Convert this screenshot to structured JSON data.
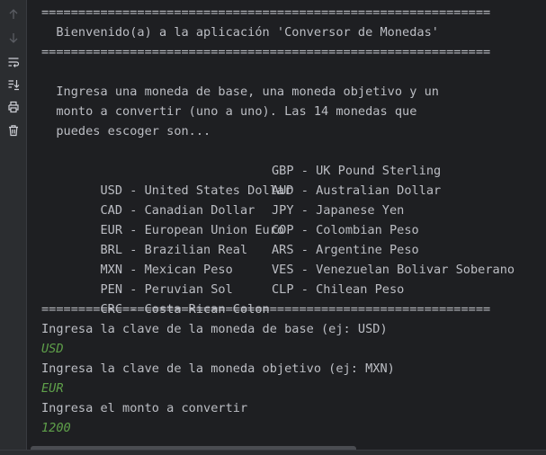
{
  "toolbar": {
    "icons": [
      "arrow-up-icon",
      "arrow-down-icon",
      "soft-wrap-icon",
      "scroll-to-end-icon",
      "print-icon",
      "trash-icon"
    ]
  },
  "console": {
    "separator": "=============================================================",
    "welcome": "  Bienvenido(a) a la aplicación 'Conversor de Monedas'",
    "intro": [
      "  Ingresa una moneda de base, una moneda objetivo y un",
      "  monto a convertir (uno a uno). Las 14 monedas que",
      "  puedes escoger son..."
    ],
    "currencies": [
      {
        "left": "  USD - United States Dollar",
        "right": "GBP - UK Pound Sterling"
      },
      {
        "left": "  CAD - Canadian Dollar",
        "right": "AUD - Australian Dollar"
      },
      {
        "left": "  EUR - European Union Euro",
        "right": "JPY - Japanese Yen"
      },
      {
        "left": "  BRL - Brazilian Real",
        "right": "COP - Colombian Peso"
      },
      {
        "left": "  MXN - Mexican Peso",
        "right": "ARS - Argentine Peso"
      },
      {
        "left": "  PEN - Peruvian Sol",
        "right": "VES - Venezuelan Bolivar Soberano"
      },
      {
        "left": "  CRC - Costa Rican Colon",
        "right": "CLP - Chilean Peso"
      }
    ],
    "prompt_base": "Ingresa la clave de la moneda de base (ej: USD)",
    "input_base": "USD",
    "prompt_target": "Ingresa la clave de la moneda objetivo (ej: MXN)",
    "input_target": "EUR",
    "prompt_amount": "Ingresa el monto a convertir",
    "input_amount": "1200"
  },
  "colors": {
    "background": "#1e1f22",
    "text": "#bcbec4",
    "user_input": "#5fa04a",
    "gutter": "#2b2d30"
  }
}
